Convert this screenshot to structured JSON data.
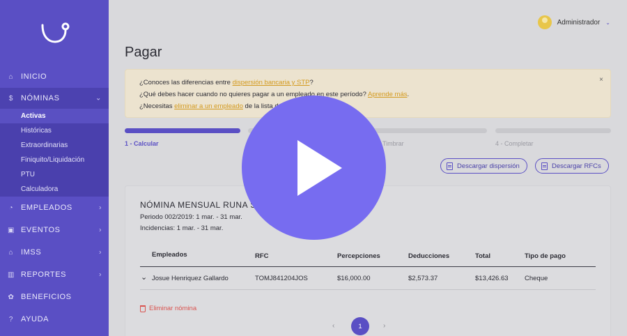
{
  "sidebar": {
    "items": [
      {
        "label": "INICIO",
        "icon": "home-icon"
      },
      {
        "label": "NÓMINAS",
        "icon": "dollar-icon"
      },
      {
        "label": "EMPLEADOS",
        "icon": "user-icon"
      },
      {
        "label": "EVENTOS",
        "icon": "calendar-icon"
      },
      {
        "label": "IMSS",
        "icon": "hospital-icon"
      },
      {
        "label": "REPORTES",
        "icon": "chart-icon"
      },
      {
        "label": "BENEFICIOS",
        "icon": "gift-icon"
      },
      {
        "label": "AYUDA",
        "icon": "question-icon"
      }
    ],
    "nominas_sub": [
      "Activas",
      "Históricas",
      "Extraordinarias",
      "Finiquito/Liquidación",
      "PTU",
      "Calculadora"
    ]
  },
  "user": {
    "name": "Administrador"
  },
  "page": {
    "title": "Pagar"
  },
  "banner": {
    "line1_pre": "¿Conoces las diferencias entre ",
    "line1_link": "dispersión bancaria y STP",
    "line1_post": "?",
    "line2_pre": "¿Qué debes hacer cuando no quieres pagar a un empleado en este período? ",
    "line2_link": "Aprende más",
    "line2_post": ".",
    "line3_pre": "¿Necesitas ",
    "line3_link": "eliminar a un empleado",
    "line3_post": " de la lista d",
    "close": "×"
  },
  "steps": [
    {
      "label": "1 - Calcular"
    },
    {
      "label": ""
    },
    {
      "label": "Timbrar"
    },
    {
      "label": "4 - Completar"
    }
  ],
  "actions": {
    "dispersion": "Descargar dispersión",
    "rfcs": "Descargar RFCs"
  },
  "payroll": {
    "title": "NÓMINA MENSUAL RUNA S.",
    "period": "Periodo 002/2019: 1 mar. - 31 mar.",
    "incidences": "Incidencias: 1 mar. - 31 mar.",
    "columns": [
      "Empleados",
      "RFC",
      "Percepciones",
      "Deducciones",
      "Total",
      "Tipo de pago"
    ],
    "rows": [
      {
        "employee": "Josue Henriquez Gallardo",
        "rfc": "TOMJ841204JOS",
        "perceptions": "$16,000.00",
        "deductions": "$2,573.37",
        "total": "$13,426.63",
        "payment_type": "Cheque"
      }
    ],
    "delete_label": "Eliminar nómina"
  },
  "pagination": {
    "current": "1",
    "prev": "‹",
    "next": "›"
  },
  "colors": {
    "brand": "#5a4fc4",
    "play": "#776cf0",
    "link": "#d39a1f",
    "danger": "#d9534f"
  }
}
